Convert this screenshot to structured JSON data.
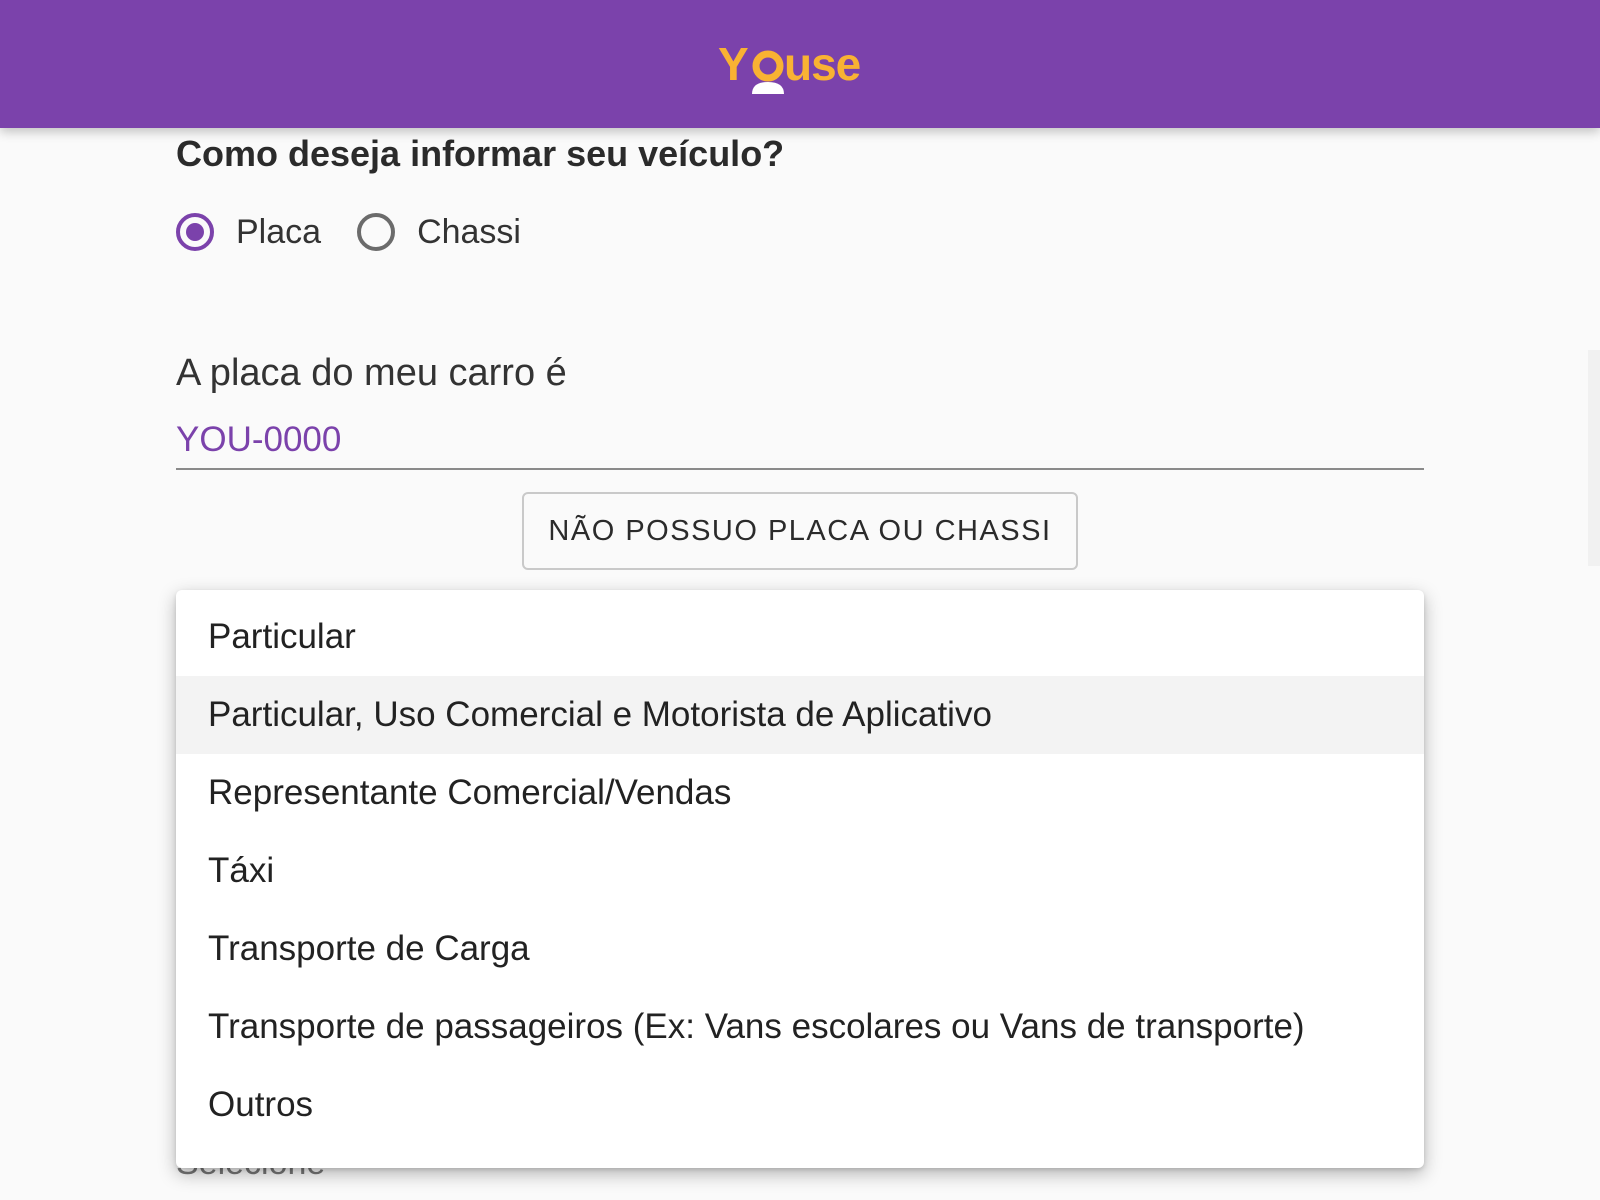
{
  "header": {
    "logo_text": "YOUSE",
    "brand_color": "#7b42ab",
    "logo_color": "#f9b233"
  },
  "vehicle_question": {
    "title": "Como deseja informar seu veículo?",
    "options": [
      {
        "label": "Placa",
        "selected": true
      },
      {
        "label": "Chassi",
        "selected": false
      }
    ]
  },
  "plate": {
    "label": "A placa do meu carro é",
    "placeholder": "YOU-0000"
  },
  "no_plate_button": {
    "label": "NÃO POSSUO PLACA OU CHASSI"
  },
  "usage_dropdown": {
    "highlighted_index": 1,
    "items": [
      "Particular",
      "Particular, Uso Comercial e Motorista de Aplicativo",
      "Representante Comercial/Vendas",
      "Táxi",
      "Transporte de Carga",
      "Transporte de passageiros (Ex: Vans escolares ou Vans de transporte)",
      "Outros"
    ]
  },
  "underlying_select": {
    "placeholder": "Selecione"
  }
}
